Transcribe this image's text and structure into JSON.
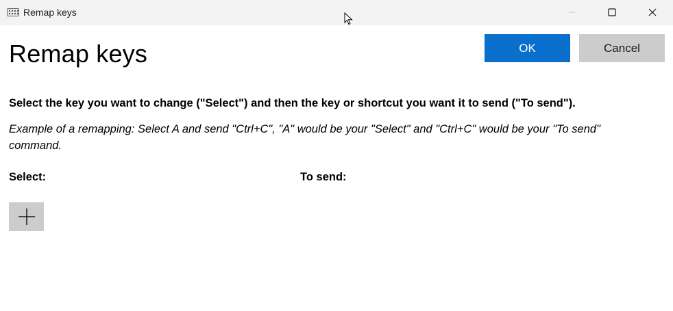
{
  "window": {
    "title": "Remap keys",
    "app_icon": "keyboard-icon",
    "controls": [
      "minimize-icon",
      "maximize-icon",
      "close-icon"
    ]
  },
  "header": {
    "title": "Remap keys",
    "ok_label": "OK",
    "cancel_label": "Cancel"
  },
  "content": {
    "instruction": "Select the key you want to change (\"Select\") and then the key or shortcut you want it to send (\"To send\").",
    "example": "Example of a remapping: Select A and send \"Ctrl+C\", \"A\" would be your \"Select\" and \"Ctrl+C\" would be your \"To send\" command.",
    "select_label": "Select:",
    "to_send_label": "To send:",
    "add_button_icon": "plus-icon"
  },
  "colors": {
    "accent": "#0a6fcc",
    "secondary_button": "#cccccc",
    "titlebar": "#f3f3f3"
  }
}
